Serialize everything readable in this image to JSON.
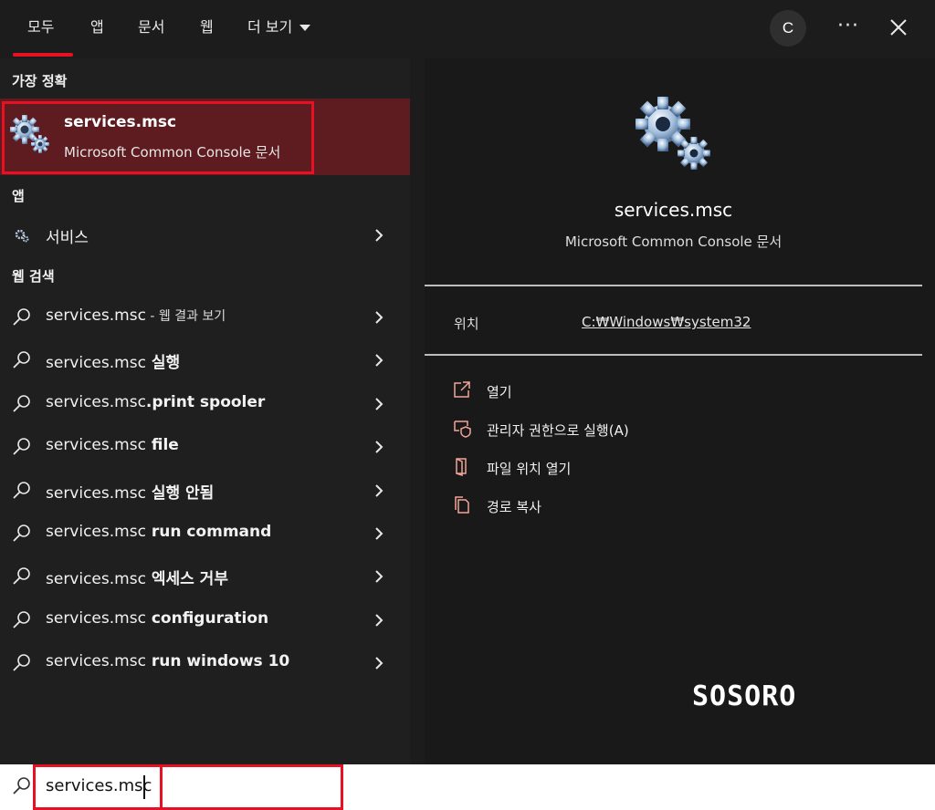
{
  "tabs": [
    {
      "label": "모두",
      "active": true
    },
    {
      "label": "앱"
    },
    {
      "label": "문서"
    },
    {
      "label": "웹"
    },
    {
      "label": "더 보기"
    }
  ],
  "account_initial": "C",
  "more_label": "···",
  "sections": {
    "best_match": "가장 정확",
    "apps": "앱",
    "web_search": "웹 검색"
  },
  "best_match": {
    "title": "services.msc",
    "subtitle": "Microsoft Common Console 문서",
    "icon": "gears-icon"
  },
  "apps": [
    {
      "label": "서비스",
      "icon": "services-icon"
    }
  ],
  "web_results": [
    {
      "prefix": "services.msc",
      "suffix": " - 웹 결과 보기",
      "suffix_style": "small"
    },
    {
      "prefix": "services.msc",
      "suffix": " 실행",
      "suffix_style": "bold"
    },
    {
      "prefix": "services.msc",
      "suffix": ".print spooler",
      "suffix_style": "bold"
    },
    {
      "prefix": "services.msc",
      "suffix": " file",
      "suffix_style": "bold"
    },
    {
      "prefix": "services.msc",
      "suffix": " 실행 안됨",
      "suffix_style": "bold"
    },
    {
      "prefix": "services.msc",
      "suffix": " run command",
      "suffix_style": "bold"
    },
    {
      "prefix": "services.msc",
      "suffix": " 엑세스 거부",
      "suffix_style": "bold"
    },
    {
      "prefix": "services.msc",
      "suffix": " configuration",
      "suffix_style": "bold"
    },
    {
      "prefix": "services.msc",
      "suffix": " run windows 10",
      "suffix_style": "bold"
    }
  ],
  "detail": {
    "title": "services.msc",
    "subtitle": "Microsoft Common Console 문서",
    "location_label": "위치",
    "location_value": "C:₩Windows₩system32",
    "actions": [
      {
        "label": "열기",
        "icon": "open-icon"
      },
      {
        "label": "관리자 권한으로 실행(A)",
        "icon": "admin-shield-icon"
      },
      {
        "label": "파일 위치 열기",
        "icon": "folder-open-icon"
      },
      {
        "label": "경로 복사",
        "icon": "copy-icon"
      }
    ]
  },
  "watermark": "SOSORO",
  "search": {
    "value": "services.msc"
  },
  "colors": {
    "accent": "#e81123",
    "selected_bg": "#5e1b20",
    "action_icon": "#f3a69a"
  }
}
